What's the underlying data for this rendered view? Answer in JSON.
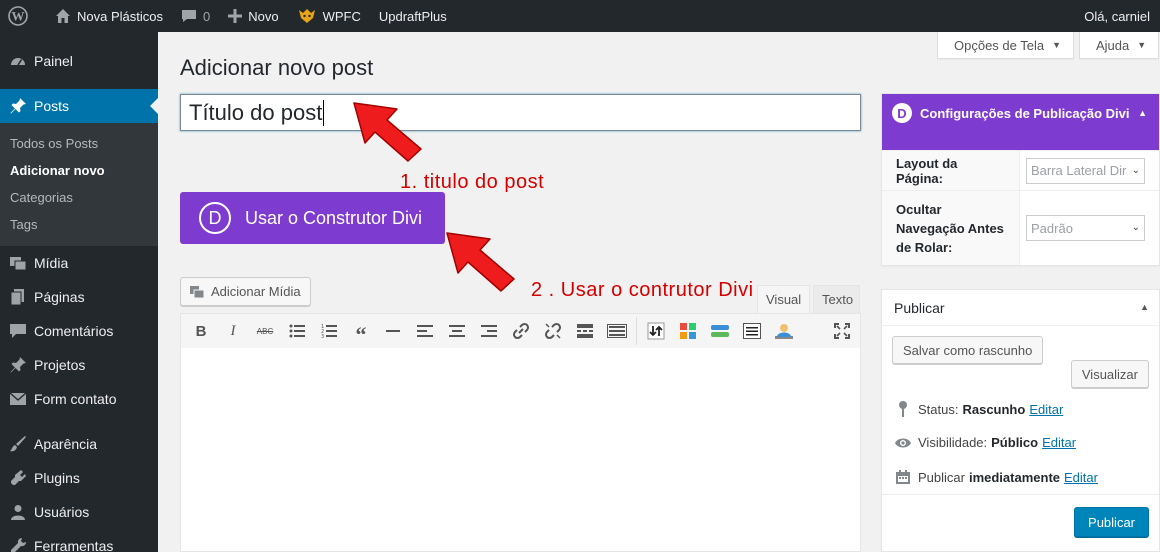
{
  "adminbar": {
    "site_name": "Nova Plásticos",
    "comments_count": "0",
    "new_label": "Novo",
    "wpfc_label": "WPFC",
    "updraft_label": "UpdraftPlus",
    "greeting": "Olá, carniel"
  },
  "sidebar": {
    "items": [
      {
        "label": "Painel",
        "icon": "dashboard-icon"
      },
      {
        "label": "Posts",
        "icon": "pin-icon"
      },
      {
        "label": "Mídia",
        "icon": "media-icon"
      },
      {
        "label": "Páginas",
        "icon": "pages-icon"
      },
      {
        "label": "Comentários",
        "icon": "comments-icon"
      },
      {
        "label": "Projetos",
        "icon": "pin-icon"
      },
      {
        "label": "Form contato",
        "icon": "mail-icon"
      },
      {
        "label": "Aparência",
        "icon": "brush-icon"
      },
      {
        "label": "Plugins",
        "icon": "plugin-icon"
      },
      {
        "label": "Usuários",
        "icon": "users-icon"
      },
      {
        "label": "Ferramentas",
        "icon": "tools-icon"
      }
    ],
    "submenu": [
      "Todos os Posts",
      "Adicionar novo",
      "Categorias",
      "Tags"
    ]
  },
  "screen_options": "Opções de Tela",
  "help": "Ajuda",
  "page_title": "Adicionar novo post",
  "title_input_value": "Título do post",
  "divi_button": {
    "letter": "D",
    "label": "Usar o Construtor Divi"
  },
  "add_media_label": "Adicionar Mídia",
  "editor_tabs": {
    "visual": "Visual",
    "text": "Texto"
  },
  "annotations": {
    "first": "1. titulo do post",
    "second": "2 .  Usar o contrutor Divi"
  },
  "divi_settings": {
    "letter": "D",
    "title": "Configurações de Publicação Divi",
    "layout_label": "Layout da Página:",
    "layout_value": "Barra Lateral Dir",
    "nav_label": "Ocultar Navegação Antes de Rolar:",
    "nav_value": "Padrão"
  },
  "publish": {
    "title": "Publicar",
    "save_draft": "Salvar como rascunho",
    "preview": "Visualizar",
    "status_label": "Status:",
    "status_value": "Rascunho",
    "visibility_label": "Visibilidade:",
    "visibility_value": "Público",
    "schedule_label": "Publicar",
    "schedule_value": "imediatamente",
    "edit_link": "Editar",
    "publish_button": "Publicar"
  },
  "colors": {
    "accent_blue": "#0073aa",
    "divi_purple": "#7e3bd0",
    "annotation_red": "#d40000",
    "admin_dark": "#23282d"
  }
}
